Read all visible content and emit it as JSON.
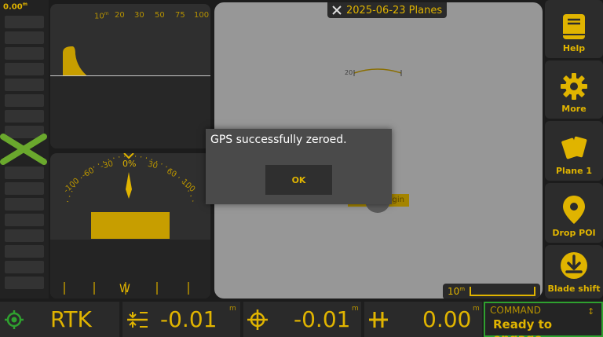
{
  "elevation": {
    "value": "0.00",
    "unit": "m"
  },
  "top_panel": {
    "scale_labels": [
      "10",
      "20",
      "30",
      "50",
      "75",
      "100"
    ],
    "scale_unit": "m"
  },
  "tilt_panel": {
    "labels": [
      "-100",
      "-60",
      "-30",
      "0%",
      "30",
      "60",
      "100"
    ],
    "heading": "W"
  },
  "map": {
    "title": "2025-06-23 Planes",
    "marker_label": "20",
    "origin_label": "gin",
    "scale_label": "10",
    "scale_unit": "m"
  },
  "sidebar": [
    {
      "label": "Help",
      "icon": "book-icon"
    },
    {
      "label": "More",
      "icon": "gear-icon"
    },
    {
      "label": "Plane 1",
      "icon": "cards-icon"
    },
    {
      "label": "Drop POI",
      "icon": "pin-icon"
    },
    {
      "label": "Blade shift",
      "icon": "download-circle-icon"
    }
  ],
  "status_bar": {
    "gps_mode": "RTK",
    "value1": "-0.01",
    "value1_unit": "m",
    "value2": "-0.01",
    "value2_unit": "m",
    "value3": "0.00",
    "value3_unit": "m",
    "command_label": "COMMAND",
    "command_status": "Ready to engage"
  },
  "dialog": {
    "message": "GPS successfully zeroed.",
    "ok_label": "OK"
  },
  "colors": {
    "accent": "#e0b400",
    "panel": "#2f2f2f",
    "map_bg": "#979797",
    "command_border": "#2fa12f",
    "x_mark": "#6aa82d"
  }
}
